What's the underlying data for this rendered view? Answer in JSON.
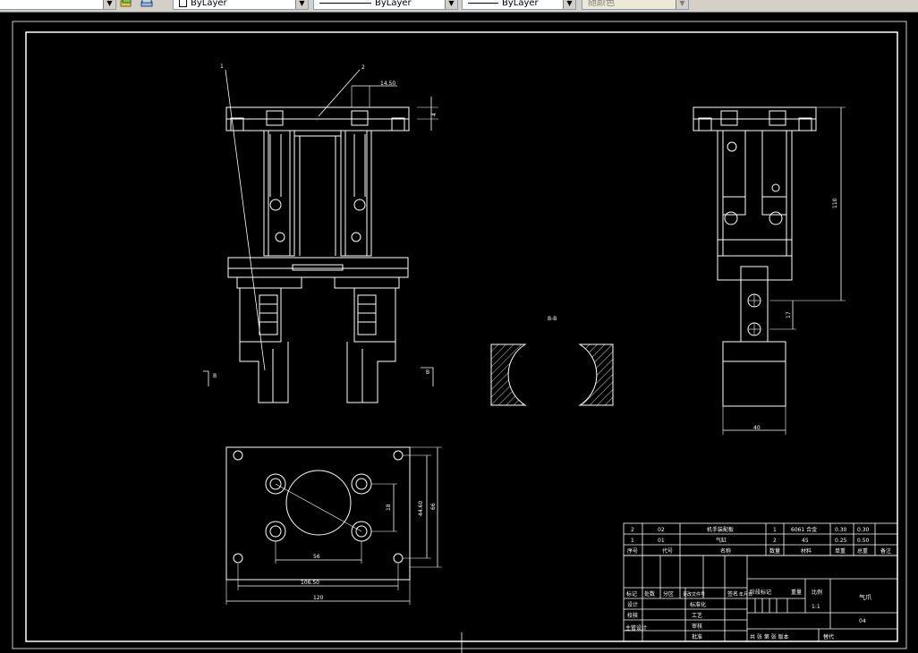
{
  "toolbar": {
    "layer_drop": "ByLayer",
    "linetype_drop": "ByLayer",
    "lineweight_drop": "ByLayer",
    "plotstyle_drop": "随颜色",
    "icons": [
      "layer-manager-icon",
      "layer-states-icon"
    ]
  },
  "drawing": {
    "balloons": [
      "1",
      "2"
    ],
    "dimensions": {
      "front_top": "14.50",
      "front_flange": "4",
      "side_height": "110",
      "side_pitch": "17",
      "side_width": "40",
      "plan_bolt_x": "56",
      "plan_bolt_y": "18",
      "plan_inner_h": "44.60",
      "plan_outer_h": "66",
      "plan_inner_w": "106.50",
      "plan_outer_w": "120"
    },
    "section_label": "B-B",
    "section_marks": [
      "B",
      "B"
    ]
  },
  "title_block": {
    "parts_list": [
      {
        "no": "2",
        "code": "02",
        "name": "机手装配板",
        "qty": "1",
        "material": "6061 合金",
        "unit_weight": "0.30",
        "total_weight": "0.30",
        "note": ""
      },
      {
        "no": "1",
        "code": "01",
        "name": "气缸",
        "qty": "2",
        "material": "45",
        "unit_weight": "0.25",
        "total_weight": "0.50",
        "note": ""
      }
    ],
    "parts_header": [
      "序号",
      "代号",
      "名称",
      "数量",
      "材料",
      "单重",
      "总重",
      "备注"
    ],
    "revision_header": [
      "标记",
      "处数",
      "分区",
      "更改文件号",
      "签名",
      "年月日"
    ],
    "roles": [
      "设计",
      "校核",
      "主管设计"
    ],
    "roles_right": [
      "标准化",
      "工艺",
      "审核",
      "批准"
    ],
    "stage_header": [
      "阶段标记",
      "重量",
      "比例"
    ],
    "scale": "1:1",
    "drawing_name": "气爪",
    "drawing_no": "04",
    "sheet_info": "共 张 第 张 版本",
    "replace": "替代"
  }
}
